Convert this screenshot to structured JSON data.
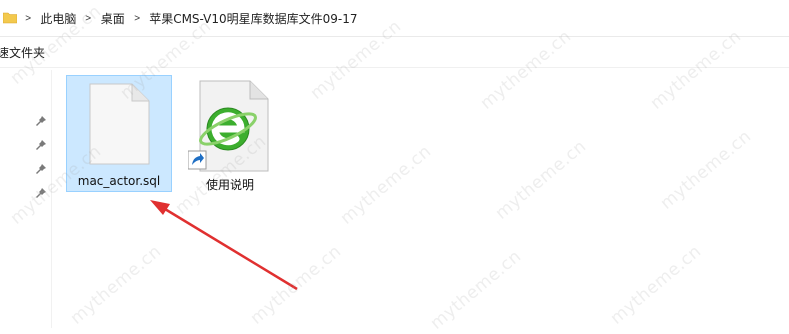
{
  "breadcrumb": {
    "items": [
      "此电脑",
      "桌面",
      "苹果CMS-V10明星库数据库文件09-17"
    ]
  },
  "nav_pane": {
    "title": "速文件夹"
  },
  "files": [
    {
      "name": "mac_actor.sql",
      "icon": "sql-file-icon",
      "selected": true
    },
    {
      "name": "使用说明",
      "icon": "browser-shortcut-icon",
      "selected": false
    }
  ],
  "watermark": "mytheme.cn",
  "colors": {
    "selection_bg": "#cce8ff",
    "selection_border": "#99d1ff",
    "arrow": "#e03030",
    "browser_green": "#3cae2e"
  }
}
